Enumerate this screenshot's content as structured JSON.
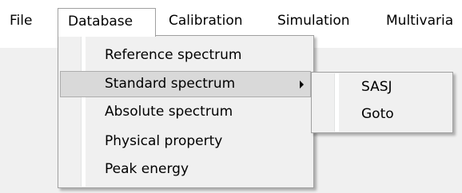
{
  "menubar": {
    "items": [
      {
        "label": "File"
      },
      {
        "label": "Database"
      },
      {
        "label": "Calibration"
      },
      {
        "label": "Simulation"
      },
      {
        "label": "Multivaria"
      }
    ]
  },
  "database_menu": {
    "items": [
      {
        "label": "Reference spectrum"
      },
      {
        "label": "Standard spectrum",
        "has_submenu": true,
        "highlighted": true
      },
      {
        "label": "Absolute spectrum"
      },
      {
        "label": "Physical property"
      },
      {
        "label": "Peak energy"
      }
    ]
  },
  "standard_spectrum_submenu": {
    "items": [
      {
        "label": "SASJ"
      },
      {
        "label": "Goto"
      }
    ]
  },
  "colors": {
    "menubar_background": "#ffffff",
    "menu_background": "#f0f0f0",
    "highlight_background": "#d9d9d9",
    "highlight_border": "#adadad",
    "menu_border": "#a0a0a0"
  }
}
